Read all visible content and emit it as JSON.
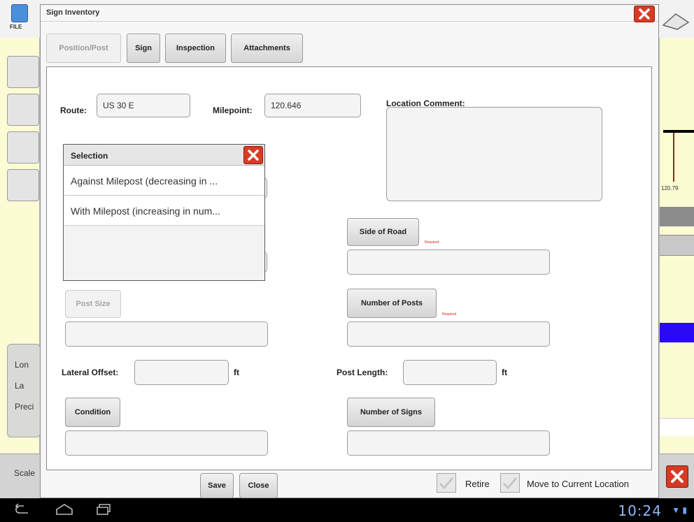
{
  "app": {
    "file_label": "FILE",
    "bg_left_labels": [
      "Lon",
      "La",
      "Preci"
    ],
    "scale_label": "Scale",
    "map_value": "120.79"
  },
  "dialog": {
    "title": "Sign Inventory",
    "tabs": [
      {
        "label": "Position/Post",
        "active": true
      },
      {
        "label": "Sign",
        "active": false
      },
      {
        "label": "Inspection",
        "active": false
      },
      {
        "label": "Attachments",
        "active": false
      }
    ],
    "route": {
      "label": "Route:",
      "value": "US 30 E"
    },
    "milepoint": {
      "label": "Milepoint:",
      "value": "120.646"
    },
    "location_comment": {
      "label": "Location Comment:",
      "value": ""
    },
    "side_of_road": {
      "label": "Side of Road",
      "required": "Required",
      "value": ""
    },
    "post_size": {
      "label": "Post Size",
      "value": ""
    },
    "number_of_posts": {
      "label": "Number of Posts",
      "required": "Required",
      "value": ""
    },
    "lateral_offset": {
      "label": "Lateral Offset:",
      "value": "",
      "unit": "ft"
    },
    "post_length": {
      "label": "Post Length:",
      "value": "",
      "unit": "ft"
    },
    "condition": {
      "label": "Condition",
      "value": ""
    },
    "number_of_signs": {
      "label": "Number of Signs",
      "value": ""
    },
    "footer": {
      "save": "Save",
      "close": "Close",
      "retire": "Retire",
      "move_to_current": "Move to Current Location"
    }
  },
  "selection_popup": {
    "title": "Selection",
    "items": [
      "Against Milepost (decreasing in ...",
      "With Milepost (increasing in num..."
    ]
  },
  "system": {
    "clock": "10:24"
  },
  "colors": {
    "close_red": "#d83b24",
    "map_yellow": "#fbfbd4",
    "map_blue": "#2a0af5",
    "clock_blue": "#8fb8ff"
  }
}
